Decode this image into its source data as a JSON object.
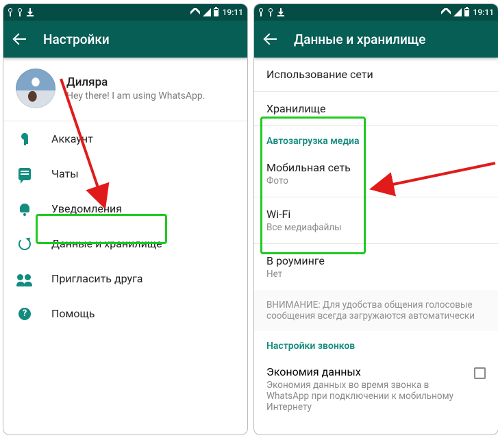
{
  "status": {
    "time": "19:11"
  },
  "left": {
    "title": "Настройки",
    "profile": {
      "name": "Диляра",
      "status": "Hey there! I am using WhatsApp."
    },
    "rows": {
      "account": "Аккаунт",
      "chats": "Чаты",
      "notifications": "Уведомления",
      "data": "Данные и хранилище",
      "invite": "Пригласить друга",
      "help": "Помощь"
    }
  },
  "right": {
    "title": "Данные и хранилище",
    "usage": "Использование сети",
    "storage": "Хранилище",
    "autodl_header": "Автозагрузка медиа",
    "mobile": {
      "title": "Мобильная сеть",
      "sub": "Фото"
    },
    "wifi": {
      "title": "Wi-Fi",
      "sub": "Все медиафайлы"
    },
    "roaming": {
      "title": "В роуминге",
      "sub": "Нет"
    },
    "notice": "ВНИМАНИЕ: Для удобства общения голосовые сообщения всегда загружаются автоматически",
    "calls_header": "Настройки звонков",
    "saver": {
      "title": "Экономия данных",
      "sub": "Экономия данных во время звонка в WhatsApp при подключении к мобильному Интернету"
    }
  }
}
